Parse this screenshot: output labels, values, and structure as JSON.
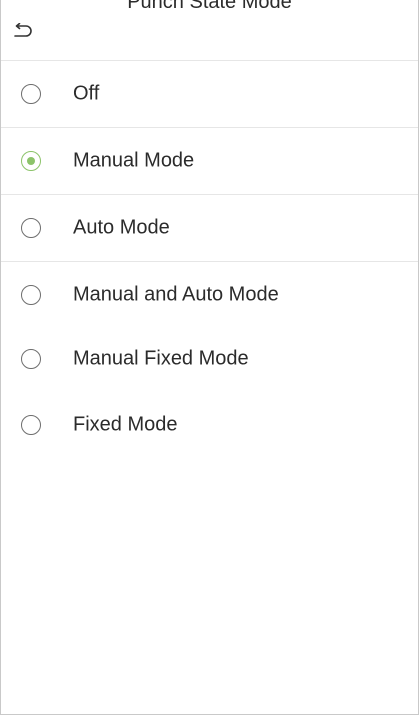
{
  "header": {
    "title": "Punch State Mode",
    "back_icon": "back-arrow-icon"
  },
  "options": [
    {
      "label": "Off",
      "selected": false
    },
    {
      "label": "Manual Mode",
      "selected": true
    },
    {
      "label": "Auto Mode",
      "selected": false
    },
    {
      "label": "Manual and Auto Mode",
      "selected": false
    },
    {
      "label": "Manual Fixed Mode",
      "selected": false
    },
    {
      "label": "Fixed Mode",
      "selected": false
    }
  ],
  "colors": {
    "accent": "#8cc36a",
    "text": "#2b2b2b",
    "divider": "#e6e6e6"
  }
}
